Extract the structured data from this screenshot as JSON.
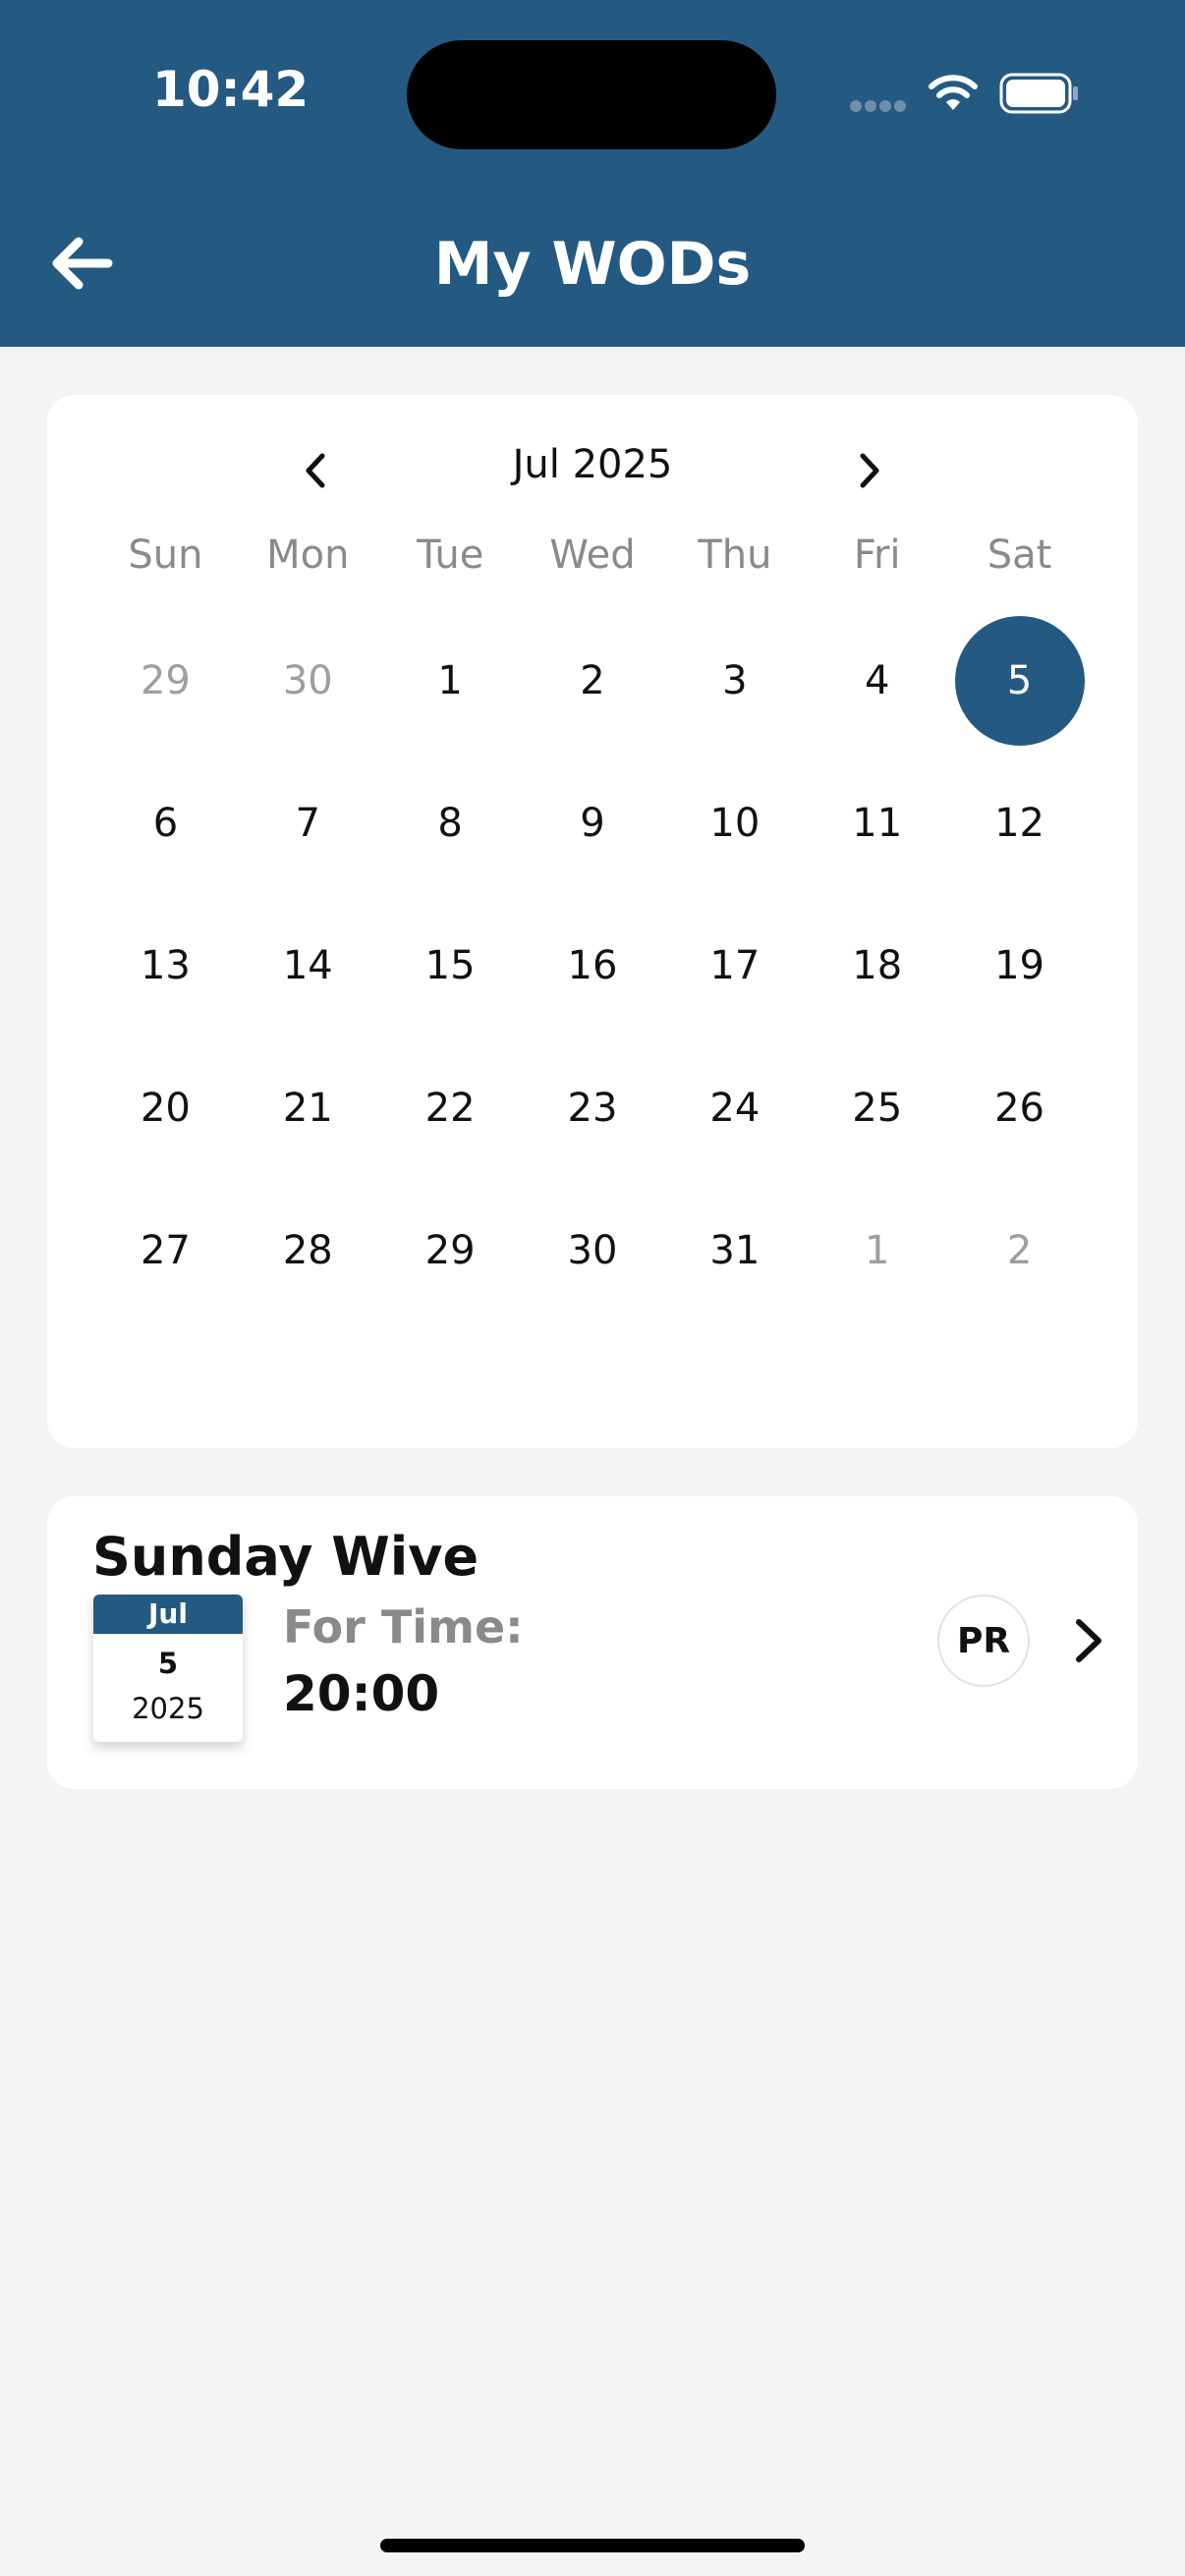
{
  "status_bar": {
    "time": "10:42"
  },
  "header": {
    "title": "My WODs",
    "back_icon": "arrow-left-icon",
    "background_color": "#245a82"
  },
  "calendar": {
    "month_label": "Jul 2025",
    "weekdays": [
      "Sun",
      "Mon",
      "Tue",
      "Wed",
      "Thu",
      "Fri",
      "Sat"
    ],
    "days": [
      {
        "label": "29",
        "muted": true
      },
      {
        "label": "30",
        "muted": true
      },
      {
        "label": "1"
      },
      {
        "label": "2"
      },
      {
        "label": "3"
      },
      {
        "label": "4"
      },
      {
        "label": "5",
        "selected": true
      },
      {
        "label": "6"
      },
      {
        "label": "7"
      },
      {
        "label": "8"
      },
      {
        "label": "9"
      },
      {
        "label": "10"
      },
      {
        "label": "11"
      },
      {
        "label": "12"
      },
      {
        "label": "13"
      },
      {
        "label": "14"
      },
      {
        "label": "15"
      },
      {
        "label": "16"
      },
      {
        "label": "17"
      },
      {
        "label": "18"
      },
      {
        "label": "19"
      },
      {
        "label": "20"
      },
      {
        "label": "21"
      },
      {
        "label": "22"
      },
      {
        "label": "23"
      },
      {
        "label": "24"
      },
      {
        "label": "25"
      },
      {
        "label": "26"
      },
      {
        "label": "27"
      },
      {
        "label": "28"
      },
      {
        "label": "29"
      },
      {
        "label": "30"
      },
      {
        "label": "31"
      },
      {
        "label": "1",
        "muted": true
      },
      {
        "label": "2",
        "muted": true
      }
    ],
    "selected_color": "#245a82"
  },
  "wod": {
    "title": "Sunday Wive",
    "badge": {
      "month": "Jul",
      "day": "5",
      "year": "2025"
    },
    "type": "For Time:",
    "value": "20:00",
    "pr_label": "PR",
    "chevron_icon": "chevron-right-icon"
  }
}
